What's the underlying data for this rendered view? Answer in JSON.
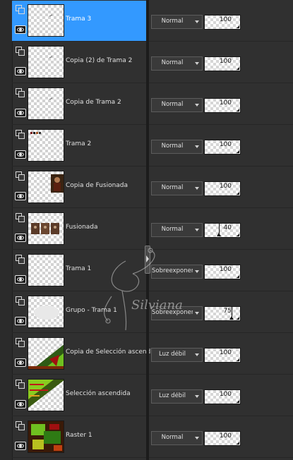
{
  "colors": {
    "selected_row": "#3399ff",
    "panel_bg": "#303030"
  },
  "watermark": {
    "text": "Silviana"
  },
  "layers": [
    {
      "name": "Trama 3",
      "blend": "Normal",
      "opacity": "100",
      "selected": true,
      "thumb": "blank-mark"
    },
    {
      "name": "Copia (2) de Trama 2",
      "blend": "Normal",
      "opacity": "100",
      "selected": false,
      "thumb": "blank-mark"
    },
    {
      "name": "Copia de Trama 2",
      "blend": "Normal",
      "opacity": "100",
      "selected": false,
      "thumb": "blank-mark"
    },
    {
      "name": "Trama 2",
      "blend": "Normal",
      "opacity": "100",
      "selected": false,
      "thumb": "small-text"
    },
    {
      "name": "Copia de Fusionada",
      "blend": "Normal",
      "opacity": "100",
      "selected": false,
      "thumb": "portrait"
    },
    {
      "name": "Fusionada",
      "blend": "Normal",
      "opacity": "40",
      "selected": false,
      "thumb": "three-frames"
    },
    {
      "name": "Trama 1",
      "blend": "Sobreexponer",
      "opacity": "100",
      "selected": false,
      "thumb": "blank"
    },
    {
      "name": "Grupo - Trama 1",
      "blend": "Sobreexponer",
      "opacity": "75",
      "selected": false,
      "thumb": "faint"
    },
    {
      "name": "Copia de Selección ascendida",
      "blend": "Luz débil",
      "opacity": "100",
      "selected": false,
      "thumb": "diagonal-lower"
    },
    {
      "name": "Selección ascendida",
      "blend": "Luz débil",
      "opacity": "100",
      "selected": false,
      "thumb": "diagonal-upper"
    },
    {
      "name": "Raster 1",
      "blend": "Normal",
      "opacity": "100",
      "selected": false,
      "thumb": "full-texture"
    }
  ]
}
